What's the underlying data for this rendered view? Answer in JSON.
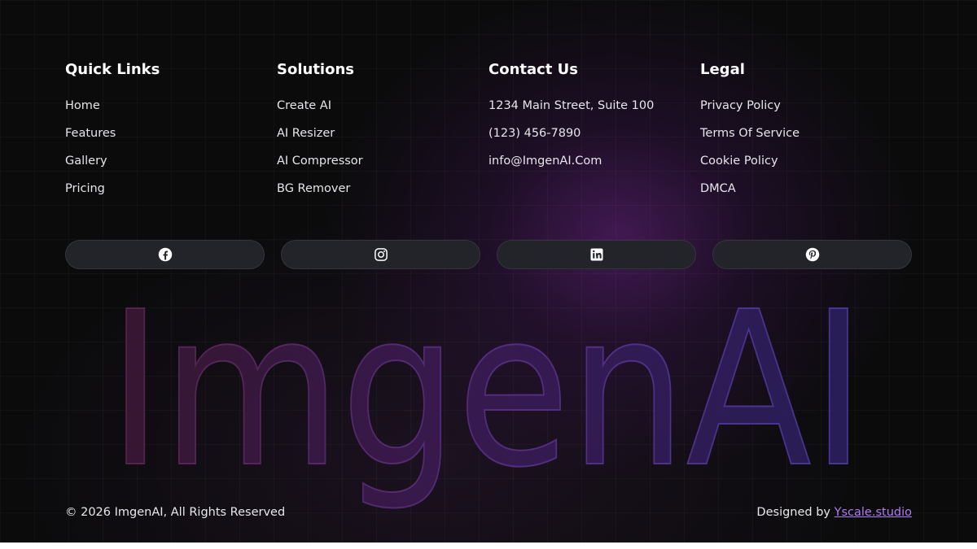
{
  "columns": [
    {
      "title": "Quick Links",
      "items": [
        "Home",
        "Features",
        "Gallery",
        "Pricing"
      ]
    },
    {
      "title": "Solutions",
      "items": [
        "Create AI",
        "AI Resizer",
        "AI Compressor",
        "BG Remover"
      ]
    },
    {
      "title": "Contact Us",
      "items": [
        "1234 Main Street, Suite 100",
        "(123) 456-7890",
        "info@ImgenAI.Com"
      ]
    },
    {
      "title": "Legal",
      "items": [
        "Privacy Policy",
        "Terms Of Service",
        "Cookie Policy",
        "DMCA"
      ]
    }
  ],
  "socials": [
    {
      "icon": "facebook-icon"
    },
    {
      "icon": "instagram-icon"
    },
    {
      "icon": "linkedin-icon"
    },
    {
      "icon": "pinterest-icon"
    }
  ],
  "wordmark": "ImgenAI",
  "bottom": {
    "copyright": "© 2026 ImgenAI, All Rights Reserved",
    "designed_by": "Designed by",
    "designer": "Yscale.studio"
  },
  "colors": {
    "background": "#0b0b0c",
    "glow": "#6e248c",
    "accent_link": "#b07cf5",
    "social_button": "#23232a",
    "wordmark_left": "#3a1732",
    "wordmark_right": "#2a1f5e"
  }
}
